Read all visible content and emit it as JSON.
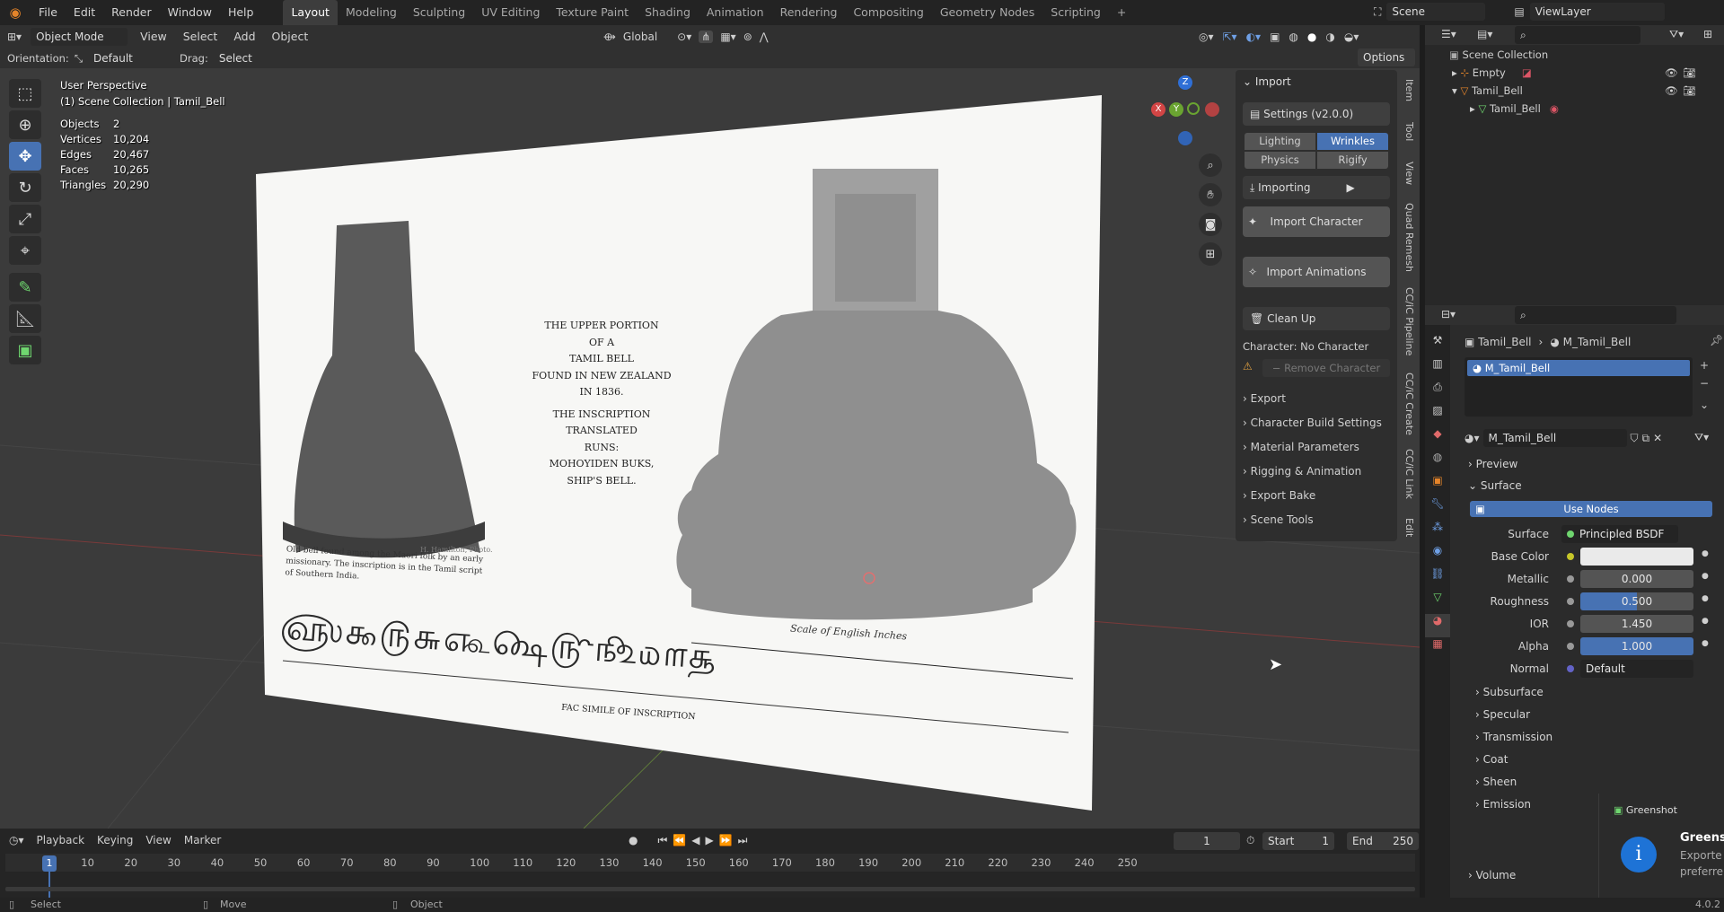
{
  "menu": {
    "items": [
      "File",
      "Edit",
      "Render",
      "Window",
      "Help"
    ]
  },
  "workspaces": [
    "Layout",
    "Modeling",
    "Sculpting",
    "UV Editing",
    "Texture Paint",
    "Shading",
    "Animation",
    "Rendering",
    "Compositing",
    "Geometry Nodes",
    "Scripting"
  ],
  "scene": {
    "name": "Scene",
    "view_layer": "ViewLayer"
  },
  "header": {
    "mode": "Object Mode",
    "menus": [
      "View",
      "Select",
      "Add",
      "Object"
    ],
    "transform": "Global",
    "options": "Options",
    "orientation_label": "Orientation:",
    "orientation_value": "Default",
    "drag_label": "Drag:",
    "drag_value": "Select Box"
  },
  "overlay": {
    "perspective": "User Perspective",
    "collection": "(1) Scene Collection | Tamil_Bell",
    "stats": [
      {
        "label": "Objects",
        "value": "2"
      },
      {
        "label": "Vertices",
        "value": "10,204"
      },
      {
        "label": "Edges",
        "value": "20,467"
      },
      {
        "label": "Faces",
        "value": "10,265"
      },
      {
        "label": "Triangles",
        "value": "20,290"
      }
    ]
  },
  "reference": {
    "title_lines": [
      "THE UPPER PORTION",
      "OF A",
      "TAMIL BELL",
      "FOUND IN NEW ZEALAND",
      "IN 1836.",
      "THE INSCRIPTION",
      "TRANSLATED",
      "RUNS:",
      "MOHOYIDEN BUKS,",
      "SHIP'S BELL."
    ],
    "caption": "Old bell found among the Maori folk by an early missionary. The inscription is in the Tamil script of Southern India.",
    "credit": "H. Hamilton, Photo.",
    "scale": "Scale of English Inches",
    "facsimile": "FAC SIMILE OF INSCRIPTION"
  },
  "gizmo": {
    "x": "X",
    "y": "Y",
    "z": "Z"
  },
  "npanel": {
    "section": "Import",
    "settings": "Settings  (v2.0.0)",
    "tabs": [
      "Lighting",
      "Wrinkles",
      "Physics",
      "Rigify"
    ],
    "importing": "Importing",
    "import_character": "Import Character",
    "import_animations": "Import Animations",
    "clean_up": "Clean Up",
    "character_status": "Character: No Character",
    "remove_character": "Remove Character",
    "sections": [
      "Export",
      "Character Build Settings",
      "Material Parameters",
      "Rigging & Animation",
      "Export Bake",
      "Scene Tools"
    ]
  },
  "side_tabs": [
    "Item",
    "Tool",
    "View",
    "Quad Remesh",
    "CC/iC Pipeline",
    "CC/iC Create",
    "CC/iC Link",
    "Edit"
  ],
  "timeline": {
    "menus": [
      "Playback",
      "Keying",
      "View",
      "Marker"
    ],
    "current_frame": "1",
    "start_label": "Start",
    "start": "1",
    "end_label": "End",
    "end": "250",
    "ticks": [
      "1",
      "10",
      "20",
      "30",
      "40",
      "50",
      "60",
      "70",
      "80",
      "90",
      "100",
      "110",
      "120",
      "130",
      "140",
      "150",
      "160",
      "170",
      "180",
      "190",
      "200",
      "210",
      "220",
      "230",
      "240",
      "250"
    ]
  },
  "status": {
    "select": "Select",
    "move": "Move",
    "object": "Object",
    "version": "4.0.2"
  },
  "outliner": {
    "root": "Scene Collection",
    "items": [
      {
        "name": "Empty",
        "indent": 1
      },
      {
        "name": "Tamil_Bell",
        "indent": 1
      },
      {
        "name": "Tamil_Bell",
        "indent": 2
      }
    ]
  },
  "properties": {
    "breadcrumb_obj": "Tamil_Bell",
    "breadcrumb_mat": "M_Tamil_Bell",
    "slot": "M_Tamil_Bell",
    "material": "M_Tamil_Bell",
    "preview": "Preview",
    "surface_section": "Surface",
    "use_nodes": "Use Nodes",
    "fields": [
      {
        "label": "Surface",
        "value": "Principled BSDF"
      },
      {
        "label": "Base Color",
        "value": ""
      },
      {
        "label": "Metallic",
        "value": "0.000"
      },
      {
        "label": "Roughness",
        "value": "0.500"
      },
      {
        "label": "IOR",
        "value": "1.450"
      },
      {
        "label": "Alpha",
        "value": "1.000"
      },
      {
        "label": "Normal",
        "value": "Default"
      }
    ],
    "subsections": [
      "Subsurface",
      "Specular",
      "Transmission",
      "Coat",
      "Sheen",
      "Emission"
    ],
    "volume": "Volume"
  },
  "notification": {
    "app": "Greenshot",
    "title": "Greens",
    "line1": "Exporte",
    "line2": "preferre"
  },
  "colors": {
    "accent": "#4772b3",
    "bg": "#3b3b3b",
    "panel": "#2e2e2e"
  }
}
